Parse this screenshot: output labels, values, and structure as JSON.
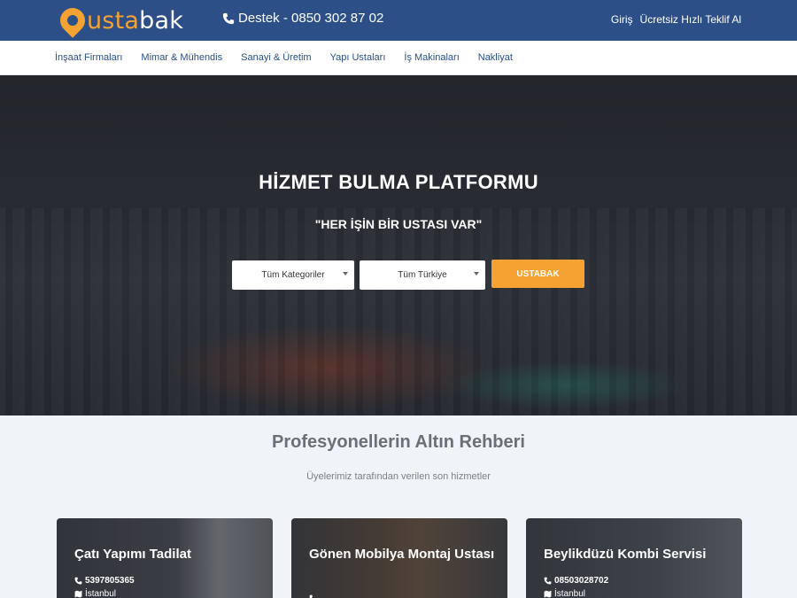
{
  "header": {
    "logo": {
      "part1": "usta",
      "part2": "bak"
    },
    "support_text": "Destek - 0850 302 87 02",
    "login": "Giriş",
    "quote": "Ücretsiz Hızlı Teklif Al"
  },
  "nav": {
    "items": [
      "İnşaat Firmaları",
      "Mimar & Mühendis",
      "Sanayi & Üretim",
      "Yapı Ustaları",
      "İş Makinaları",
      "Nakliyat"
    ]
  },
  "hero": {
    "title": "HİZMET BULMA PLATFORMU",
    "subtitle": "\"HER İŞİN BİR USTASI VAR\"",
    "category_select": "Tüm Kategoriler",
    "location_select": "Tüm Türkiye",
    "search_button": "USTABAK"
  },
  "section": {
    "title": "Profesyonellerin Altın Rehberi",
    "subtitle": "Üyelerimiz tarafından verilen son hizmetler"
  },
  "cards": [
    {
      "title": "Çatı Yapımı Tadilat",
      "phone": "5397805365",
      "city": "İstanbul"
    },
    {
      "title": "Gönen Mobilya Montaj Ustası",
      "phone": "",
      "city": ""
    },
    {
      "title": "Beylikdüzü Kombi Servisi",
      "phone": "08503028702",
      "city": "İstanbul"
    }
  ],
  "colors": {
    "primary": "#2c4f87",
    "accent": "#f5a233",
    "background": "#f0f3f7"
  }
}
